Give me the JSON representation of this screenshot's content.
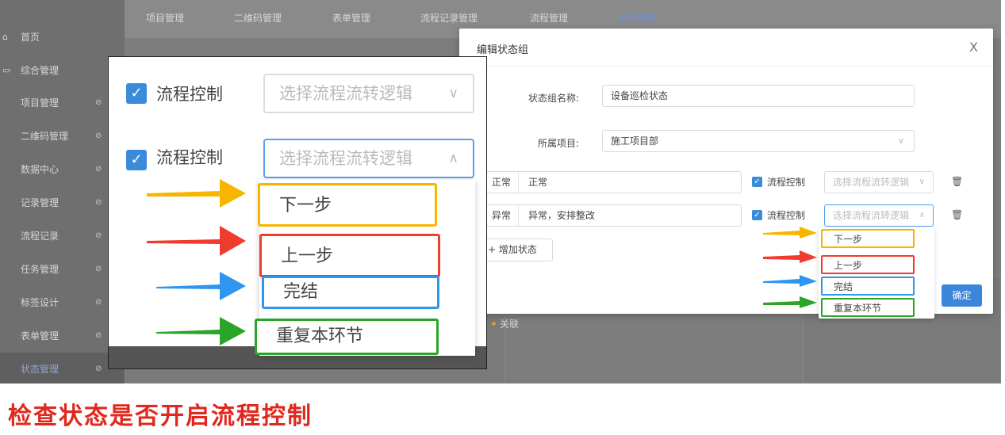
{
  "sidebar": {
    "home": {
      "icon": "home-icon",
      "label": "首页"
    },
    "group": {
      "icon": "folder-icon",
      "label": "综合管理"
    },
    "items": [
      "项目管理",
      "二维码管理",
      "数据中心",
      "记录管理",
      "流程记录",
      "任务管理",
      "标签设计",
      "表单管理",
      "状态管理"
    ],
    "arrow_glyph": "⊘"
  },
  "topnav": {
    "items": [
      "项目管理",
      "二维码管理",
      "表单管理",
      "流程记录管理",
      "流程管理",
      "状态管理"
    ],
    "active": "状态管理"
  },
  "background": {
    "link_label": "关联"
  },
  "dialog": {
    "title": "编辑状态组",
    "close_glyph": "X",
    "name_label": "状态组名称:",
    "name_value": "设备巡检状态",
    "project_label": "所属项目:",
    "project_value": "施工项目部",
    "project_chevron": "∨",
    "rows": [
      {
        "status": "正常",
        "value": "正常",
        "dot_color": "#4caf50",
        "checkbox_label": "流程控制",
        "select_placeholder": "选择流程流转逻辑",
        "chevron": "∨"
      },
      {
        "status": "异常",
        "value": "异常，安排整改",
        "dot_color": "#e53935",
        "checkbox_label": "流程控制",
        "select_placeholder": "选择流程流转逻辑",
        "chevron": "∧"
      }
    ],
    "add_button": "+ 增加状态",
    "confirm_button": "确定",
    "dropdown_options": [
      "下一步",
      "上一步",
      "完结",
      "重复本环节"
    ]
  },
  "zoom": {
    "rows": [
      {
        "checkbox_label": "流程控制",
        "select_placeholder": "选择流程流转逻辑",
        "chevron": "∨"
      },
      {
        "checkbox_label": "流程控制",
        "select_placeholder": "选择流程流转逻辑",
        "chevron": "∧"
      }
    ],
    "options": [
      "下一步",
      "上一步",
      "完结",
      "重复本环节"
    ]
  },
  "annotation": {
    "arrow_colors": [
      "#f7b500",
      "#f03c2e",
      "#2f96f0",
      "#2aa52a"
    ],
    "caption": "检查状态是否开启流程控制",
    "caption_color": "#e0281e"
  }
}
